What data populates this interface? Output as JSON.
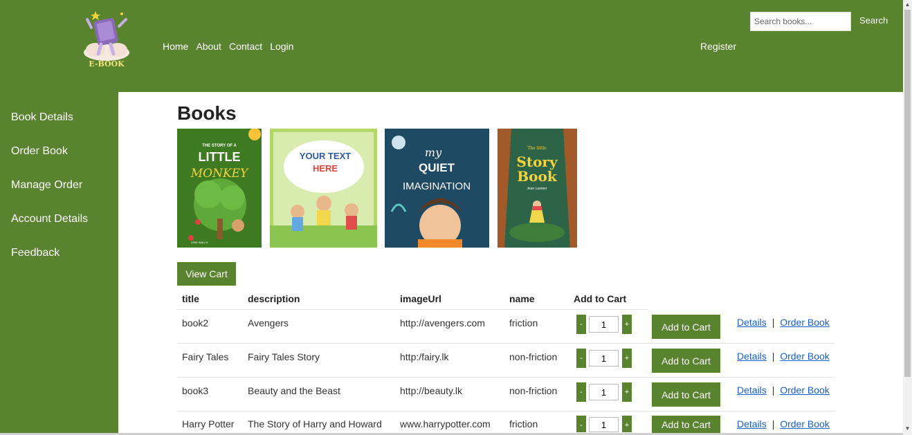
{
  "header": {
    "logo_text": "E-BOOK",
    "nav": [
      "Home",
      "About",
      "Contact",
      "Login"
    ],
    "register": "Register",
    "search_placeholder": "Search books...",
    "search_button": "Search"
  },
  "sidebar": {
    "items": [
      "Book Details",
      "Order Book",
      "Manage Order",
      "Account Details",
      "Feedback"
    ]
  },
  "main": {
    "title": "Books",
    "covers": [
      {
        "line1": "THE STORY OF A",
        "line2": "LITTLE",
        "line3": "MONKEY",
        "author": "GRIE WALLS"
      },
      {
        "line1": "YOUR TEXT",
        "line2": "HERE"
      },
      {
        "line1": "my",
        "line2": "QUIET",
        "line3": "IMAGINATION"
      },
      {
        "line1": "The little",
        "line2": "Story",
        "line3": "Book",
        "author": "Jean Luemer"
      }
    ],
    "view_cart": "View Cart",
    "table": {
      "headers": [
        "title",
        "description",
        "imageUrl",
        "name",
        "Add to Cart"
      ],
      "rows": [
        {
          "title": "book2",
          "description": "Avengers",
          "imageUrl": "http://avengers.com",
          "name": "friction",
          "qty": "1"
        },
        {
          "title": "Fairy Tales",
          "description": "Fairy Tales Story",
          "imageUrl": "http:/fairy.lk",
          "name": "non-friction",
          "qty": "1"
        },
        {
          "title": "book3",
          "description": "Beauty and the Beast",
          "imageUrl": "http://beauty.lk",
          "name": "non-friction",
          "qty": "1"
        },
        {
          "title": "Harry Potter",
          "description": "The Story of Harry and Howard",
          "imageUrl": "www.harrypotter.com",
          "name": "friction",
          "qty": "1"
        }
      ],
      "minus": "-",
      "plus": "+",
      "add_to_cart": "Add to Cart",
      "details_link": "Details",
      "separator": "|",
      "order_link": "Order Book"
    }
  },
  "colors": {
    "brand_green": "#5a832f",
    "link_blue": "#1a5fc9"
  }
}
